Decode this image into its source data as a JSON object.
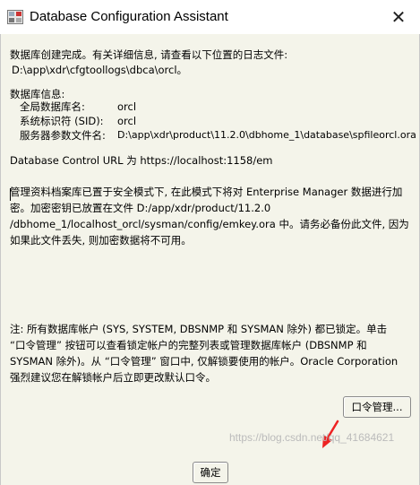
{
  "window": {
    "title": "Database Configuration Assistant",
    "close_glyph": "✕"
  },
  "message": {
    "intro_line1": "数据库创建完成。有关详细信息, 请查看以下位置的日志文件:",
    "intro_line2": "D:\\app\\xdr\\cfgtoollogs\\dbca\\orcl。",
    "db_info_heading": "数据库信息:",
    "global_db_name_label": "全局数据库名:",
    "global_db_name_value": "orcl",
    "sid_label": "系统标识符 (SID):",
    "sid_value": "orcl",
    "spfile_label": "服务器参数文件名:",
    "spfile_value": "D:\\app\\xdr\\product\\11.2.0\\dbhome_1\\database\\spfileorcl.ora",
    "control_url": "Database Control URL 为 https://localhost:1158/em",
    "mgmt_line1": "管理资料档案库已置于安全模式下, 在此模式下将对 Enterprise Manager 数据进行加",
    "mgmt_line2": "密。加密密钥已放置在文件 D:/app/xdr/product/11.2.0",
    "mgmt_line3": "/dbhome_1/localhost_orcl/sysman/config/emkey.ora 中。请务必备份此文件, 因为",
    "mgmt_line4": "如果此文件丢失, 则加密数据将不可用。",
    "note_line1": "注: 所有数据库帐户 (SYS, SYSTEM, DBSNMP 和 SYSMAN 除外) 都已锁定。单击",
    "note_line2": "“口令管理” 按钮可以查看锁定帐户的完整列表或管理数据库帐户 (DBSNMP 和",
    "note_line3": "SYSMAN 除外)。从 “口令管理” 窗口中, 仅解锁要使用的帐户。Oracle Corporation",
    "note_line4": "强烈建议您在解锁帐户后立即更改默认口令。"
  },
  "buttons": {
    "password_mgmt": "口令管理...",
    "ok": "确定"
  },
  "watermark": "https://blog.csdn.net/qq_41684621",
  "colors": {
    "content_bg": "#f4f4ea",
    "arrow": "#ee2222"
  },
  "icons": {
    "app": "database-app-icon",
    "close": "close-icon",
    "annotation": "red-arrow-icon"
  }
}
